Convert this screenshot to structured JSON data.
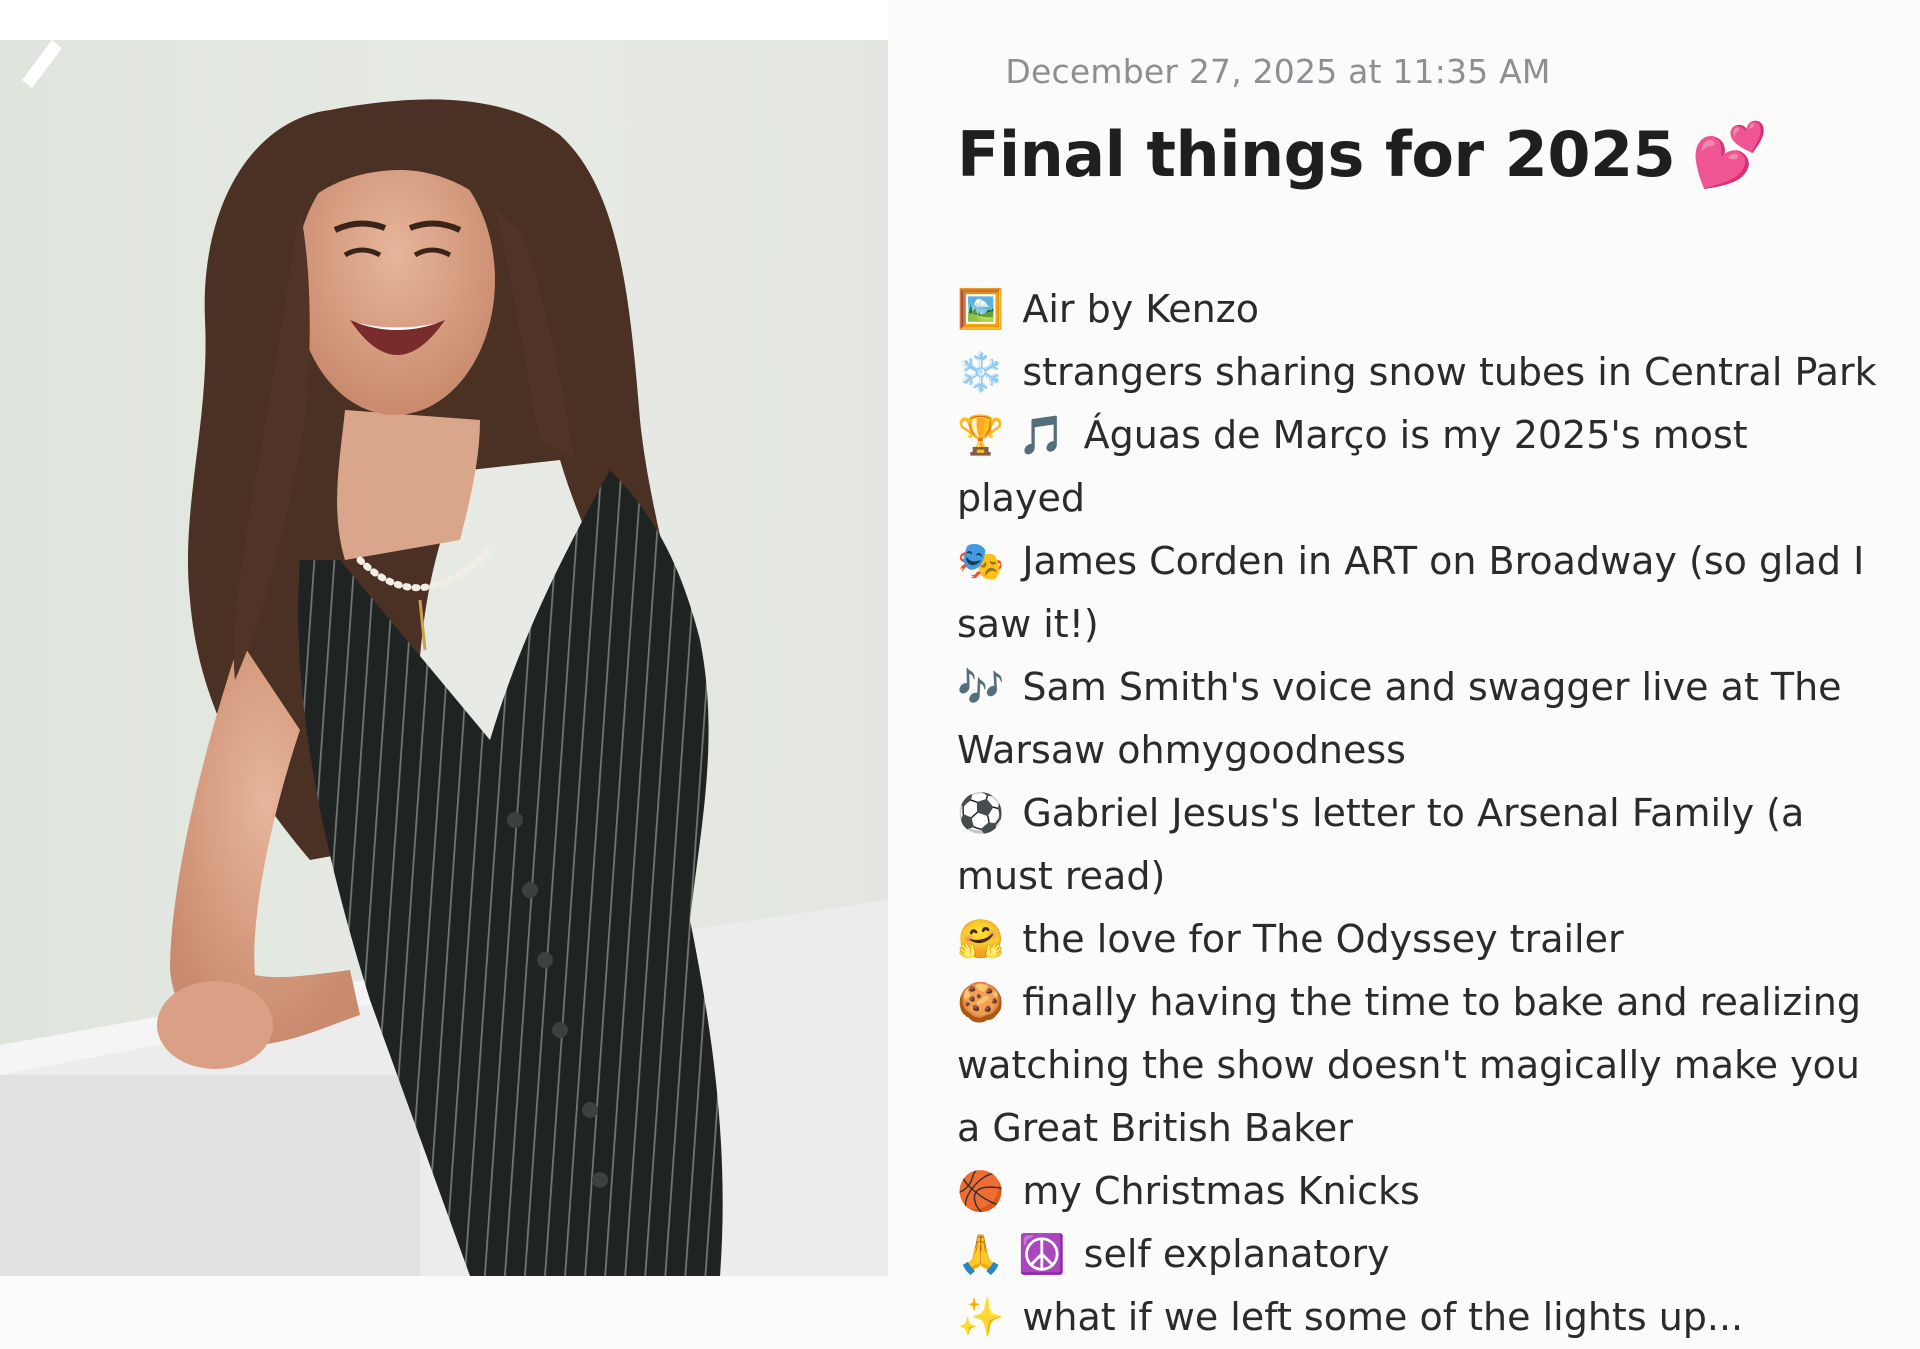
{
  "note": {
    "date": "December 27, 2025 at 11:35 AM",
    "title": "Final things for 2025",
    "title_emoji": "💕",
    "items": [
      {
        "emoji": [
          "🖼️"
        ],
        "text": "Air by Kenzo"
      },
      {
        "emoji": [
          "❄️"
        ],
        "text": "strangers sharing snow tubes in Central Park"
      },
      {
        "emoji": [
          "🏆",
          "🎵"
        ],
        "text": "Águas de Março is my 2025's most played"
      },
      {
        "emoji": [
          "🎭"
        ],
        "text": "James Corden in ART on Broadway (so glad I saw it!)"
      },
      {
        "emoji": [
          "🎶"
        ],
        "text": "Sam Smith's voice and swagger live at The Warsaw ohmygoodness"
      },
      {
        "emoji": [
          "⚽"
        ],
        "text": "Gabriel Jesus's letter to Arsenal Family (a must read)"
      },
      {
        "emoji": [
          "🤗"
        ],
        "text": "the love for The Odyssey trailer"
      },
      {
        "emoji": [
          "🍪"
        ],
        "text": "finally having the time to bake and realizing watching the show doesn't magically make you a Great British Baker"
      },
      {
        "emoji": [
          "🏀"
        ],
        "text": "my Christmas Knicks"
      },
      {
        "emoji": [
          "🙏",
          "☮️"
        ],
        "text": "self explanatory"
      },
      {
        "emoji": [
          "✨"
        ],
        "text": "what if we left some of the lights up..."
      }
    ]
  },
  "colors": {
    "date": "#8e8e93",
    "title": "#1f1f1f",
    "body_text": "#2b2b2b",
    "background": "#fbfbfb"
  }
}
